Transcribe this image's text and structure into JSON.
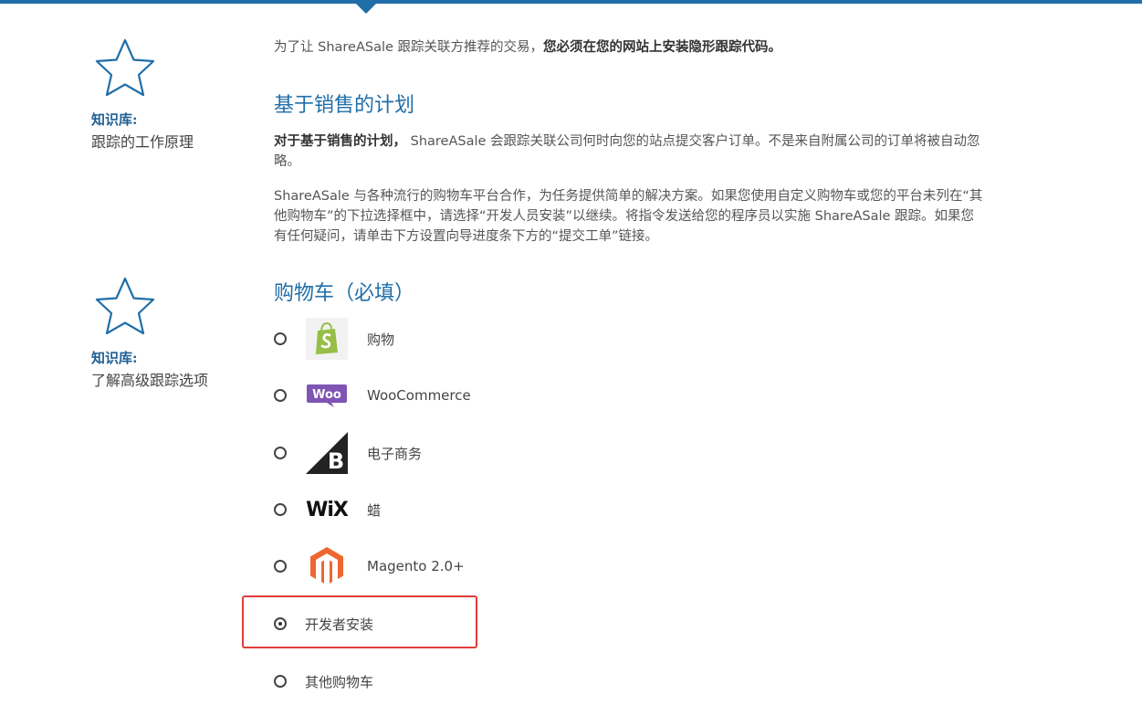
{
  "knowledge_base": [
    {
      "label": "知识库:",
      "link": "跟踪的工作原理"
    },
    {
      "label": "知识库:",
      "link": "了解高级跟踪选项"
    }
  ],
  "intro": {
    "text_prefix": "为了让 ShareASale 跟踪关联方推荐的交易，",
    "text_bold": "您必须在您的网站上安装隐形跟踪代码。"
  },
  "sales_plan": {
    "heading": "基于销售的计划",
    "p1_bold": "对于基于销售的计划，",
    "p1_rest": " ShareASale 会跟踪关联公司何时向您的站点提交客户订单。不是来自附属公司的订单将被自动忽略。",
    "p2": "ShareASale 与各种流行的购物车平台合作，为任务提供简单的解决方案。如果您使用自定义购物车或您的平台未列在“其他购物车”的下拉选择框中，请选择“开发人员安装”以继续。将指令发送给您的程序员以实施 ShareASale 跟踪。如果您有任何疑问，请单击下方设置向导进度条下方的“提交工单”链接。"
  },
  "cart": {
    "heading": "购物车（必填）",
    "options": [
      {
        "label": "购物",
        "logo": "shopify-logo",
        "checked": false
      },
      {
        "label": "WooCommerce",
        "logo": "woocommerce-logo",
        "logo_text": "Woo",
        "checked": false
      },
      {
        "label": "电子商务",
        "logo": "bigcommerce-logo",
        "checked": false
      },
      {
        "label": "蜡",
        "logo": "wix-logo",
        "logo_text": "WiX",
        "checked": false
      },
      {
        "label": "Magento 2.0+",
        "logo": "magento-logo",
        "checked": false
      },
      {
        "label": "开发者安装",
        "logo": null,
        "checked": true
      },
      {
        "label": "其他购物车",
        "logo": null,
        "checked": false
      }
    ]
  },
  "colors": {
    "accent": "#1f6ea8",
    "highlight": "#e23b3b",
    "shopify": "#95bf47",
    "woo": "#7f54b3",
    "magento": "#ee672f"
  }
}
